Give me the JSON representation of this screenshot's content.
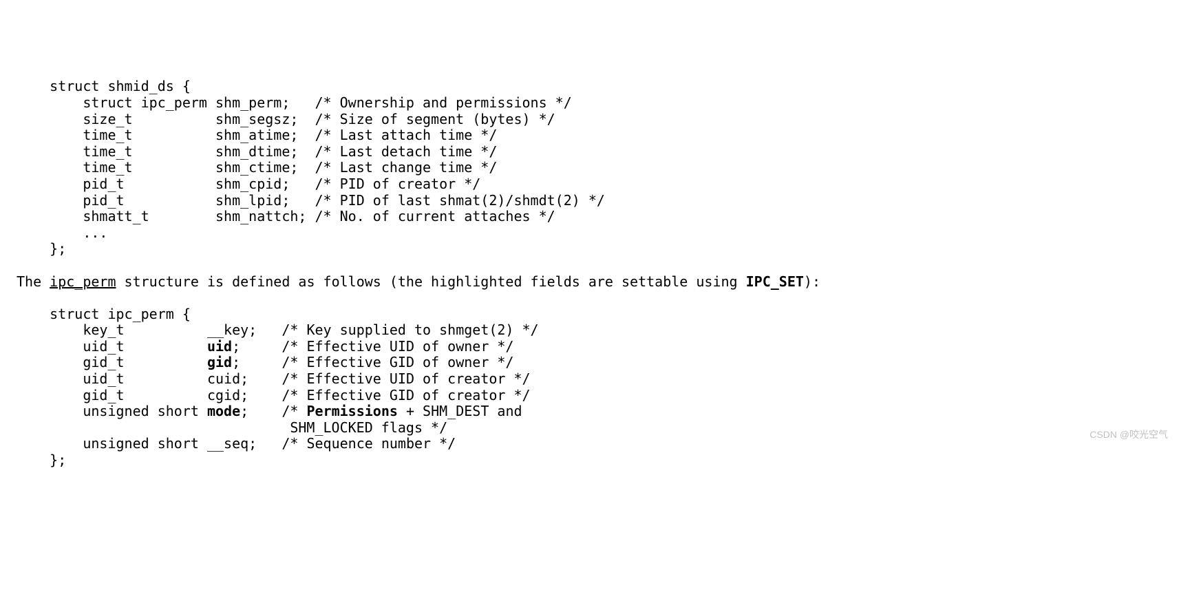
{
  "shmid_ds": {
    "header": "    struct shmid_ds {",
    "fields": [
      {
        "type": "        struct ipc_perm ",
        "name": "shm_perm;   ",
        "comment": "/* Ownership and permissions */"
      },
      {
        "type": "        size_t          ",
        "name": "shm_segsz;  ",
        "comment": "/* Size of segment (bytes) */"
      },
      {
        "type": "        time_t          ",
        "name": "shm_atime;  ",
        "comment": "/* Last attach time */"
      },
      {
        "type": "        time_t          ",
        "name": "shm_dtime;  ",
        "comment": "/* Last detach time */"
      },
      {
        "type": "        time_t          ",
        "name": "shm_ctime;  ",
        "comment": "/* Last change time */"
      },
      {
        "type": "        pid_t           ",
        "name": "shm_cpid;   ",
        "comment": "/* PID of creator */"
      },
      {
        "type": "        pid_t           ",
        "name": "shm_lpid;   ",
        "comment": "/* PID of last shmat(2)/shmdt(2) */"
      },
      {
        "type": "        shmatt_t        ",
        "name": "shm_nattch; ",
        "comment": "/* No. of current attaches */"
      }
    ],
    "ellipsis": "        ...",
    "footer": "    };"
  },
  "intertext": {
    "p1": "The ",
    "ipc_perm": "ipc_perm",
    "p2": " structure is defined as follows (the highlighted fields are settable using ",
    "ipc_set": "IPC_SET",
    "p3": "):"
  },
  "ipc_perm_struct": {
    "header": "    struct ipc_perm {",
    "rows": [
      {
        "type": "        key_t          ",
        "name": "__key;   ",
        "bold": false,
        "comment": "/* Key supplied to shmget(2) */"
      },
      {
        "type": "        uid_t          ",
        "name": "uid",
        "bold": true,
        "suffix": ";     ",
        "comment": "/* Effective UID of owner */"
      },
      {
        "type": "        gid_t          ",
        "name": "gid",
        "bold": true,
        "suffix": ";     ",
        "comment": "/* Effective GID of owner */"
      },
      {
        "type": "        uid_t          ",
        "name": "cuid;    ",
        "bold": false,
        "comment": "/* Effective UID of creator */"
      },
      {
        "type": "        gid_t          ",
        "name": "cgid;    ",
        "bold": false,
        "comment": "/* Effective GID of creator */"
      }
    ],
    "mode_row": {
      "type": "        unsigned short ",
      "name": "mode",
      "suffix": ";    ",
      "c_open": "/* ",
      "c_perm": "Permissions",
      "c_mid": " + SHM_DEST and",
      "c_line2": "                                 SHM_LOCKED flags */"
    },
    "seq_row": {
      "type": "        unsigned short ",
      "name": "__seq;   ",
      "comment": "/* Sequence number */"
    },
    "footer": "    };"
  },
  "watermark": "CSDN @咬光空气"
}
